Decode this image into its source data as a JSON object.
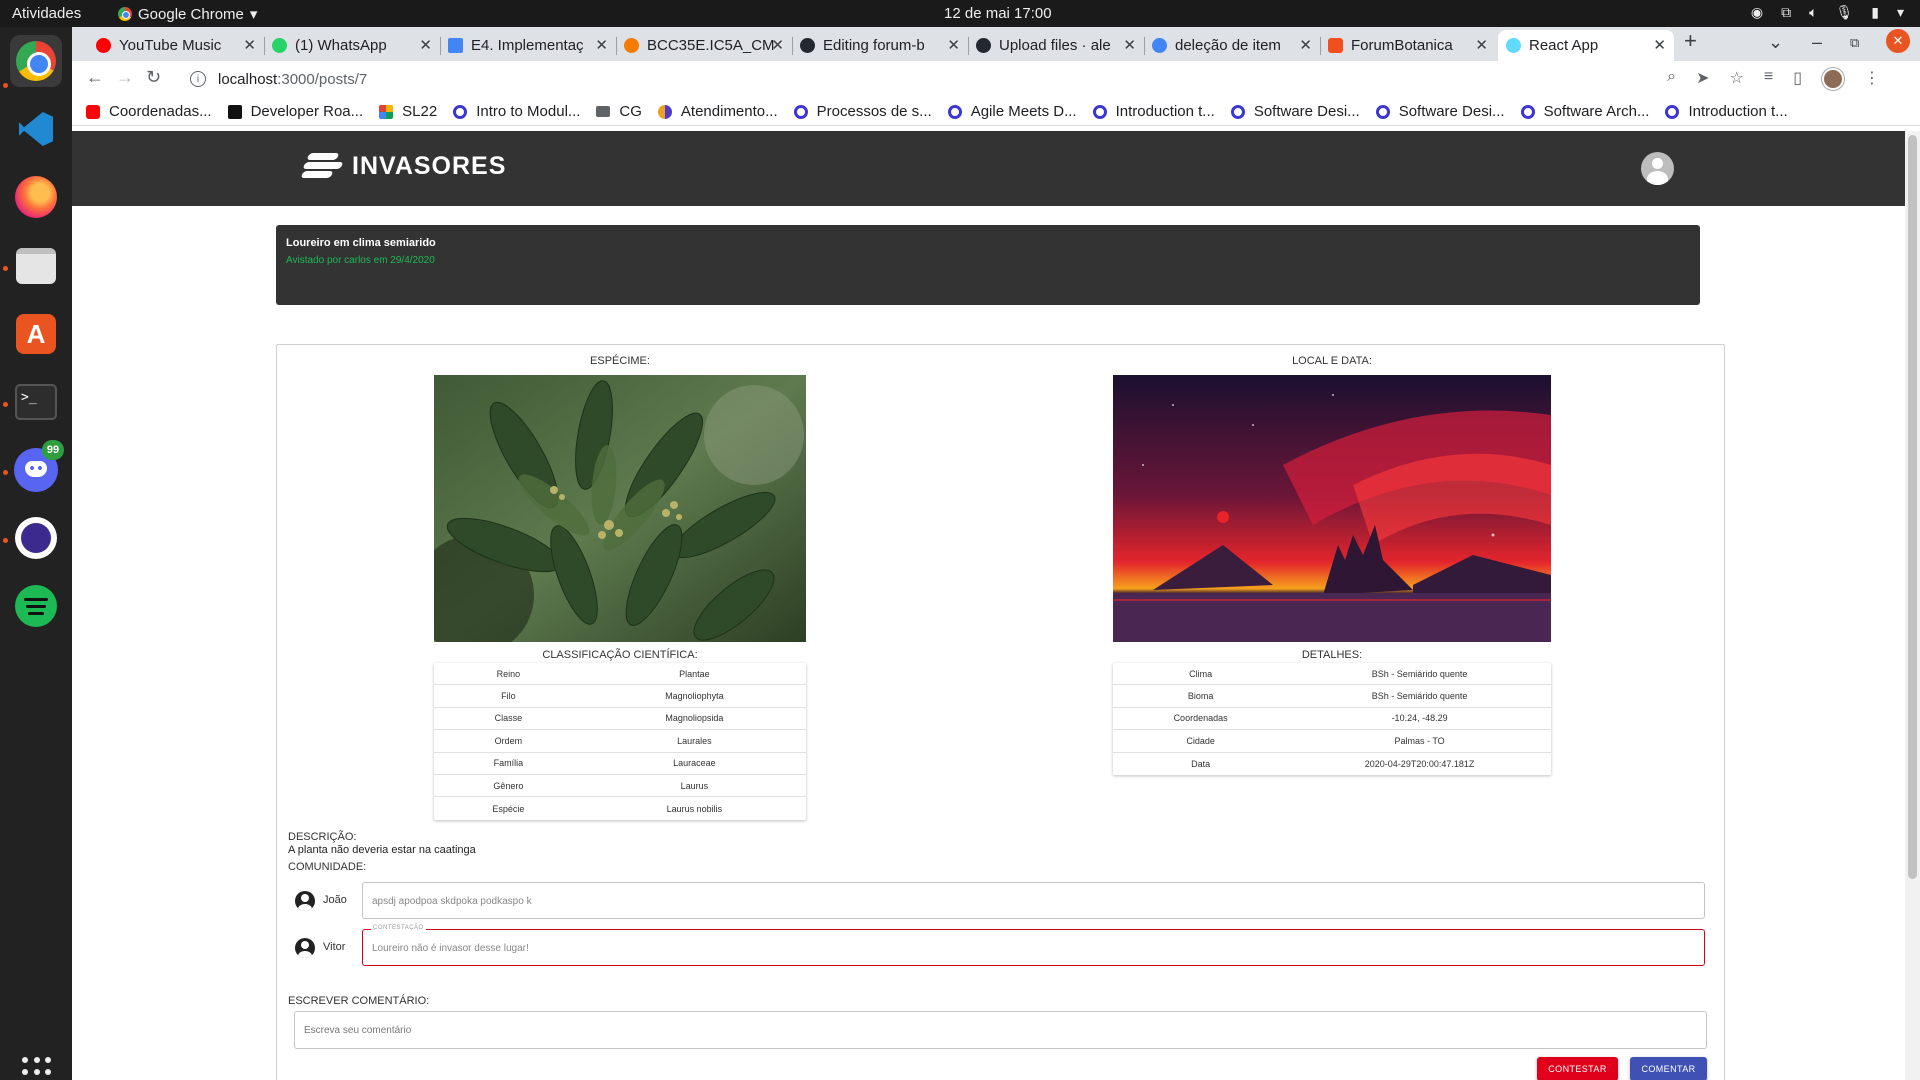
{
  "desktop": {
    "activities": "Atividades",
    "app_name": "Google Chrome",
    "clock": "12 de mai  17:00",
    "dock_badge": "99"
  },
  "browser": {
    "tabs": [
      {
        "title": "YouTube Music",
        "color": "#ff0000"
      },
      {
        "title": "(1) WhatsApp",
        "color": "#25d366"
      },
      {
        "title": "E4. Implementaç",
        "color": "#4285f4"
      },
      {
        "title": "BCC35E.IC5A_CM",
        "color": "#f57c00"
      },
      {
        "title": "Editing forum-b",
        "color": "#24292f"
      },
      {
        "title": "Upload files · ale",
        "color": "#24292f"
      },
      {
        "title": "deleção de item",
        "color": "#4285f4"
      },
      {
        "title": "ForumBotanica",
        "color": "#f24e1e"
      },
      {
        "title": "React App",
        "color": "#61dafb"
      }
    ],
    "url_host": "localhost",
    "url_path": ":3000/posts/7",
    "bookmarks": [
      {
        "label": "Coordenadas...",
        "icon": "yt"
      },
      {
        "label": "Developer Roa...",
        "icon": "dev"
      },
      {
        "label": "SL22",
        "icon": "sl"
      },
      {
        "label": "Intro to Modul...",
        "icon": "g"
      },
      {
        "label": "CG",
        "icon": "folder"
      },
      {
        "label": "Atendimento...",
        "icon": "at"
      },
      {
        "label": "Processos de s...",
        "icon": "g"
      },
      {
        "label": "Agile Meets D...",
        "icon": "g"
      },
      {
        "label": "Introduction t...",
        "icon": "g"
      },
      {
        "label": "Software Desi...",
        "icon": "g"
      },
      {
        "label": "Software Desi...",
        "icon": "g"
      },
      {
        "label": "Software Arch...",
        "icon": "g"
      },
      {
        "label": "Introduction t...",
        "icon": "g"
      }
    ]
  },
  "app": {
    "logo_text": "INVASORES",
    "post": {
      "title": "Loureiro em clima semiarido",
      "meta": "Avistado por carlos em 29/4/2020"
    },
    "specimen_label": "ESPÉCIME:",
    "location_label": "LOCAL E DATA:",
    "classification_label": "CLASSIFICAÇÃO CIENTÍFICA:",
    "details_label": "DETALHES:",
    "classification": [
      {
        "k": "Reino",
        "v": "Plantae"
      },
      {
        "k": "Filo",
        "v": "Magnoliophyta"
      },
      {
        "k": "Classe",
        "v": "Magnoliopsida"
      },
      {
        "k": "Ordem",
        "v": "Laurales"
      },
      {
        "k": "Família",
        "v": "Lauraceae"
      },
      {
        "k": "Gênero",
        "v": "Laurus"
      },
      {
        "k": "Espécie",
        "v": "Laurus nobilis"
      }
    ],
    "details": [
      {
        "k": "Clima",
        "v": "BSh - Semiárido quente"
      },
      {
        "k": "Bioma",
        "v": "BSh - Semiárido quente"
      },
      {
        "k": "Coordenadas",
        "v": "-10.24, -48.29"
      },
      {
        "k": "Cidade",
        "v": "Palmas - TO"
      },
      {
        "k": "Data",
        "v": "2020-04-29T20:00:47.181Z"
      }
    ],
    "description_label": "DESCRIÇÃO:",
    "description": "A planta não deveria estar na caatinga",
    "community_label": "COMUNIDADE:",
    "comments": [
      {
        "user": "João",
        "text": "apsdj apodpoa skdpoka podkaspo k",
        "legend": ""
      },
      {
        "user": "Vitor",
        "text": "Loureiro não é invasor desse lugar!",
        "legend": "CONTESTAÇÃO"
      }
    ],
    "write_label": "ESCREVER COMENTÁRIO:",
    "write_placeholder": "Escreva seu comentário",
    "contest_button": "CONTESTAR",
    "comment_button": "COMENTAR"
  }
}
